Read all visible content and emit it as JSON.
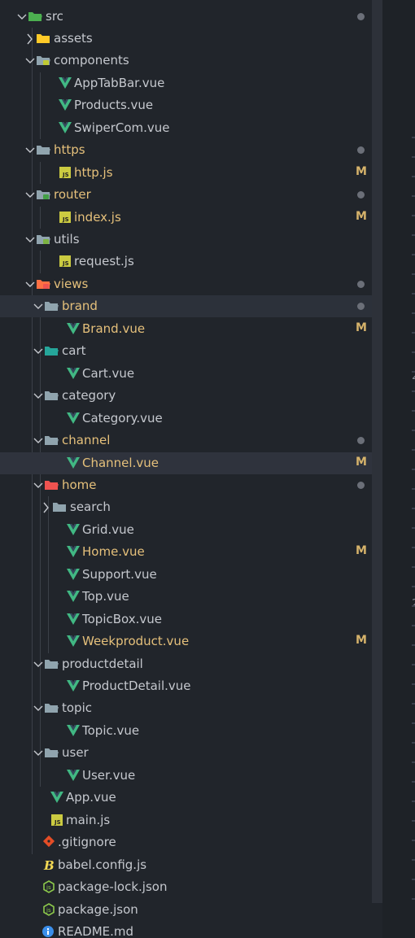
{
  "colors": {
    "vue": "#41b883",
    "js": "#cbcb41",
    "folder": "#90a4ae",
    "modified": "#e5c07b",
    "git": "#e44d26",
    "readme": "#3b8eea"
  },
  "tree": [
    {
      "label": "src",
      "depth": 0,
      "type": "folder",
      "icon": "folder-src-icon",
      "open": true,
      "dot": true
    },
    {
      "label": "assets",
      "depth": 1,
      "type": "folder",
      "icon": "folder-assets-icon",
      "open": false
    },
    {
      "label": "components",
      "depth": 1,
      "type": "folder",
      "icon": "folder-components-icon",
      "open": true
    },
    {
      "label": "AppTabBar.vue",
      "depth": 2,
      "type": "vue",
      "icon": "vue-icon"
    },
    {
      "label": "Products.vue",
      "depth": 2,
      "type": "vue",
      "icon": "vue-icon"
    },
    {
      "label": "SwiperCom.vue",
      "depth": 2,
      "type": "vue",
      "icon": "vue-icon"
    },
    {
      "label": "https",
      "depth": 1,
      "type": "folder",
      "icon": "folder-icon",
      "open": true,
      "dot": true,
      "modified": true
    },
    {
      "label": "http.js",
      "depth": 2,
      "type": "js",
      "icon": "js-icon",
      "badge": "M",
      "modified": true
    },
    {
      "label": "router",
      "depth": 1,
      "type": "folder",
      "icon": "folder-router-icon",
      "open": true,
      "dot": true,
      "modified": true
    },
    {
      "label": "index.js",
      "depth": 2,
      "type": "js",
      "icon": "js-icon",
      "badge": "M",
      "modified": true
    },
    {
      "label": "utils",
      "depth": 1,
      "type": "folder",
      "icon": "folder-utils-icon",
      "open": true
    },
    {
      "label": "request.js",
      "depth": 2,
      "type": "js",
      "icon": "js-icon"
    },
    {
      "label": "views",
      "depth": 1,
      "type": "folder",
      "icon": "folder-views-icon",
      "open": true,
      "dot": true,
      "modified": true
    },
    {
      "label": "brand",
      "depth": 2,
      "type": "folder",
      "icon": "folder-icon",
      "open": true,
      "dot": true,
      "modified": true,
      "highlight": true
    },
    {
      "label": "Brand.vue",
      "depth": 3,
      "type": "vue",
      "icon": "vue-icon",
      "badge": "M",
      "modified": true
    },
    {
      "label": "cart",
      "depth": 2,
      "type": "folder",
      "icon": "folder-cart-icon",
      "open": true
    },
    {
      "label": "Cart.vue",
      "depth": 3,
      "type": "vue",
      "icon": "vue-icon"
    },
    {
      "label": "category",
      "depth": 2,
      "type": "folder",
      "icon": "folder-icon",
      "open": true
    },
    {
      "label": "Category.vue",
      "depth": 3,
      "type": "vue",
      "icon": "vue-icon"
    },
    {
      "label": "channel",
      "depth": 2,
      "type": "folder",
      "icon": "folder-icon",
      "open": true,
      "dot": true,
      "modified": true
    },
    {
      "label": "Channel.vue",
      "depth": 3,
      "type": "vue",
      "icon": "vue-icon",
      "badge": "M",
      "modified": true,
      "selected": true
    },
    {
      "label": "home",
      "depth": 2,
      "type": "folder",
      "icon": "folder-home-icon",
      "open": true,
      "dot": true,
      "modified": true
    },
    {
      "label": "search",
      "depth": 3,
      "type": "folder",
      "icon": "folder-icon",
      "open": false
    },
    {
      "label": "Grid.vue",
      "depth": 3,
      "type": "vue",
      "icon": "vue-icon"
    },
    {
      "label": "Home.vue",
      "depth": 3,
      "type": "vue",
      "icon": "vue-icon",
      "badge": "M",
      "modified": true
    },
    {
      "label": "Support.vue",
      "depth": 3,
      "type": "vue",
      "icon": "vue-icon"
    },
    {
      "label": "Top.vue",
      "depth": 3,
      "type": "vue",
      "icon": "vue-icon"
    },
    {
      "label": "TopicBox.vue",
      "depth": 3,
      "type": "vue",
      "icon": "vue-icon"
    },
    {
      "label": "Weekproduct.vue",
      "depth": 3,
      "type": "vue",
      "icon": "vue-icon",
      "badge": "M",
      "modified": true
    },
    {
      "label": "productdetail",
      "depth": 2,
      "type": "folder",
      "icon": "folder-icon",
      "open": true
    },
    {
      "label": "ProductDetail.vue",
      "depth": 3,
      "type": "vue",
      "icon": "vue-icon"
    },
    {
      "label": "topic",
      "depth": 2,
      "type": "folder",
      "icon": "folder-icon",
      "open": true
    },
    {
      "label": "Topic.vue",
      "depth": 3,
      "type": "vue",
      "icon": "vue-icon"
    },
    {
      "label": "user",
      "depth": 2,
      "type": "folder",
      "icon": "folder-icon",
      "open": true
    },
    {
      "label": "User.vue",
      "depth": 3,
      "type": "vue",
      "icon": "vue-icon"
    },
    {
      "label": "App.vue",
      "depth": 1,
      "type": "vue",
      "icon": "vue-icon"
    },
    {
      "label": "main.js",
      "depth": 1,
      "type": "js",
      "icon": "js-icon"
    },
    {
      "label": ".gitignore",
      "depth": 0,
      "type": "git",
      "icon": "git-icon"
    },
    {
      "label": "babel.config.js",
      "depth": 0,
      "type": "babel",
      "icon": "babel-icon"
    },
    {
      "label": "package-lock.json",
      "depth": 0,
      "type": "node",
      "icon": "nodejs-icon"
    },
    {
      "label": "package.json",
      "depth": 0,
      "type": "node",
      "icon": "nodejs-icon"
    },
    {
      "label": "README.md",
      "depth": 0,
      "type": "info",
      "icon": "info-icon"
    }
  ],
  "gutter_digits": [
    "2",
    "2"
  ]
}
